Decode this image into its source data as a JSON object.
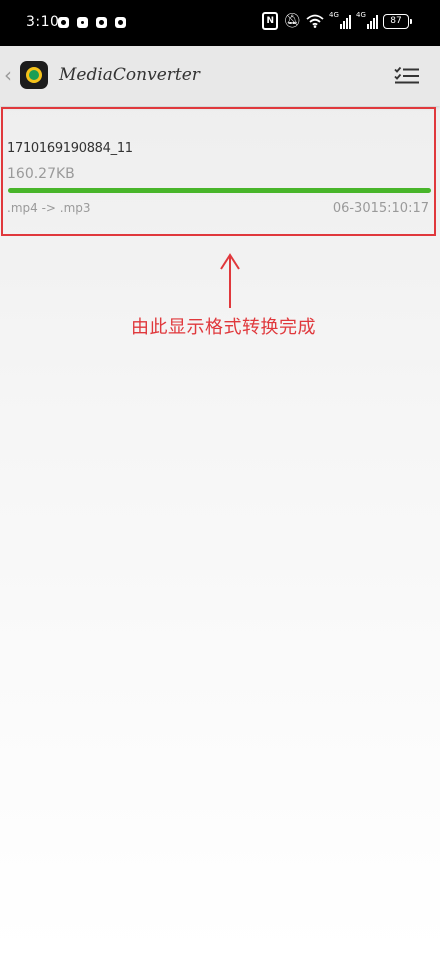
{
  "status_bar": {
    "time": "3:10",
    "notification_icons": [
      "notification-icon",
      "notification-icon",
      "notification-icon",
      "notification-icon"
    ],
    "nfc_label": "N",
    "signal_1_label": "4G",
    "signal_2_label": "4G",
    "battery": "87"
  },
  "app_bar": {
    "title": "MediaConverter",
    "back_icon": "chevron-left-icon",
    "menu_icon": "checklist-icon"
  },
  "task": {
    "name": "1710169190884_11",
    "size": "160.27KB",
    "progress": 1.0,
    "format": ".mp4 -> .mp3",
    "time": "06-3015:10:17",
    "progress_color": "#48b52a"
  },
  "annotation": {
    "text": "由此显示格式转换完成",
    "color": "#e0383c"
  }
}
